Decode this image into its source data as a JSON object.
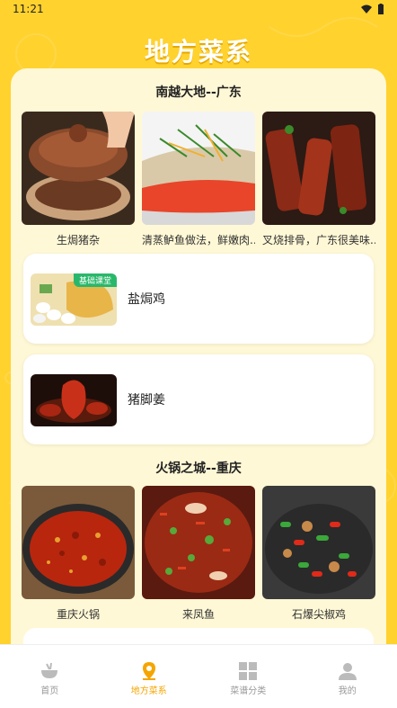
{
  "status": {
    "time": "11:21"
  },
  "header": {
    "title": "地方菜系"
  },
  "sections": [
    {
      "title": "南越大地--广东",
      "grid": [
        {
          "caption": "生焗猪杂",
          "icon": "claypot-photo"
        },
        {
          "caption": "清蒸鲈鱼做法，鲜嫩肉...",
          "icon": "steamed-fish-photo"
        },
        {
          "caption": "叉烧排骨，广东很美味...",
          "icon": "char-siu-ribs-photo"
        }
      ],
      "list": [
        {
          "name": "盐焗鸡",
          "badge": "基础课堂",
          "icon": "salt-baked-chicken-photo"
        },
        {
          "name": "猪脚姜",
          "icon": "pork-trotter-ginger-photo"
        }
      ]
    },
    {
      "title": "火锅之城--重庆",
      "grid": [
        {
          "caption": "重庆火锅",
          "icon": "hotpot-photo"
        },
        {
          "caption": "来凤鱼",
          "icon": "laifeng-fish-photo"
        },
        {
          "caption": "石爆尖椒鸡",
          "icon": "pepper-chicken-photo"
        }
      ]
    }
  ],
  "tabbar": {
    "items": [
      {
        "label": "首页",
        "icon": "home-bowl-icon"
      },
      {
        "label": "地方菜系",
        "icon": "location-pin-icon",
        "active": true
      },
      {
        "label": "菜谱分类",
        "icon": "grid-icon"
      },
      {
        "label": "我的",
        "icon": "person-icon"
      }
    ]
  },
  "colors": {
    "accent": "#F5A500",
    "background": "#FFD22E",
    "panel": "#FFF8D6"
  }
}
